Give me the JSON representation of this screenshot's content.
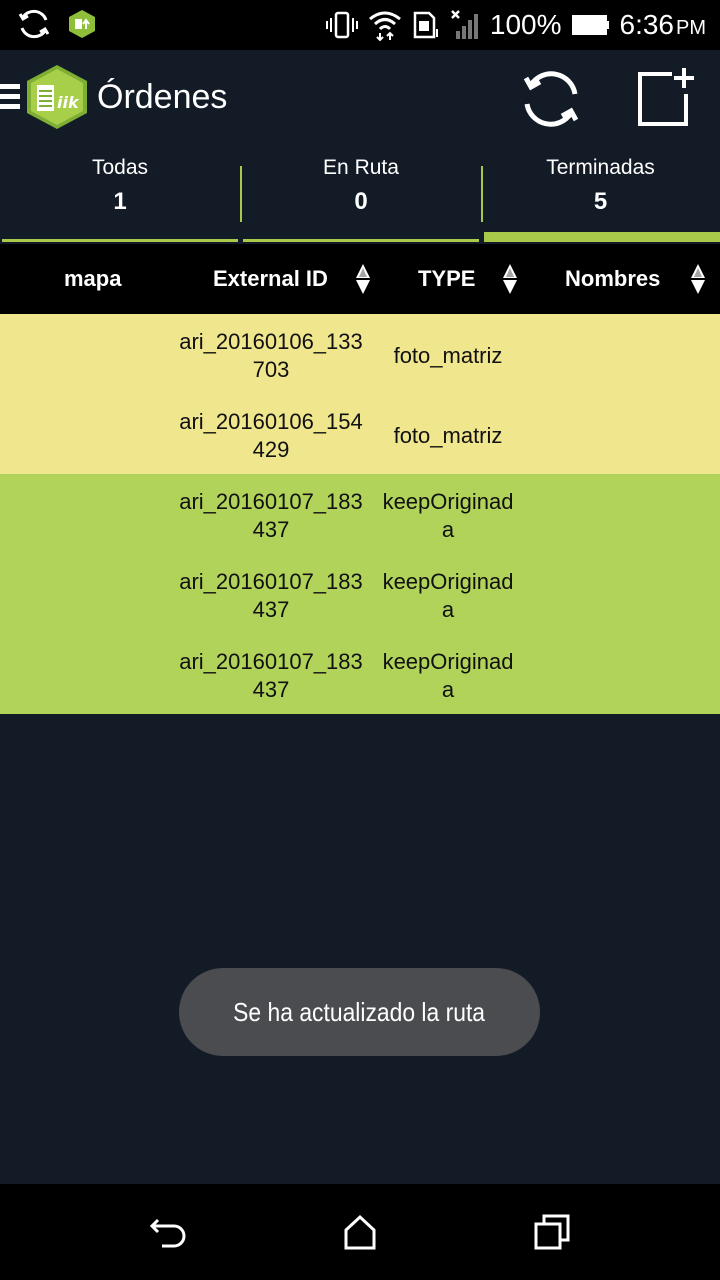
{
  "status_bar": {
    "battery": "100%",
    "time": "6:36",
    "ampm": "PM",
    "icons": [
      "sync-icon",
      "app-update-icon",
      "vibrate-icon",
      "wifi-icon",
      "sim-icon",
      "no-signal-icon",
      "battery-icon"
    ]
  },
  "app_bar": {
    "title": "Órdenes",
    "logo_text": "iik",
    "icons": [
      "menu-icon",
      "refresh-icon",
      "add-order-icon"
    ]
  },
  "tabs": [
    {
      "label": "Todas",
      "count": "1"
    },
    {
      "label": "En Ruta",
      "count": "0"
    },
    {
      "label": "Terminadas",
      "count": "5",
      "active": true
    }
  ],
  "table": {
    "columns": [
      "mapa",
      "External ID",
      "TYPE",
      "Nombres"
    ],
    "rows": [
      {
        "external_id": "ari_20160106_133703",
        "type": "foto_matriz",
        "color": "#efe68e"
      },
      {
        "external_id": "ari_20160106_154429",
        "type": "foto_matriz",
        "color": "#efe68e"
      },
      {
        "external_id": "ari_20160107_183437",
        "type": "keepOriginada",
        "color": "#b2d35a"
      },
      {
        "external_id": "ari_20160107_183437",
        "type": "keepOriginada",
        "color": "#b2d35a"
      },
      {
        "external_id": "ari_20160107_183437",
        "type": "keepOriginada",
        "color": "#b2d35a"
      }
    ]
  },
  "toast": {
    "message": "Se ha actualizado la ruta"
  },
  "colors": {
    "accent": "#a9c94a",
    "background": "#131b26",
    "row_pending": "#efe68e",
    "row_done": "#b2d35a"
  },
  "nav_bar": {
    "icons": [
      "back-icon",
      "home-icon",
      "recents-icon"
    ]
  }
}
